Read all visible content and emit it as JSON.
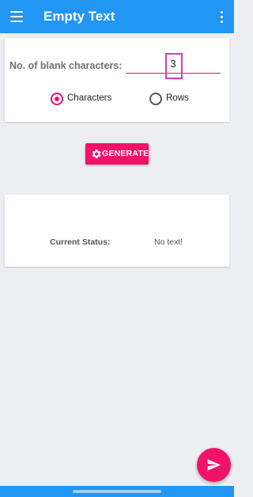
{
  "appbar": {
    "title": "Empty Text",
    "menu_icon": "hamburger-menu-icon",
    "more_icon": "more-vertical-icon",
    "color": "#2196f3"
  },
  "form": {
    "label": "No. of blank characters:",
    "input_value": "3",
    "radio_options": [
      {
        "label": "Characters",
        "checked": true
      },
      {
        "label": "Rows",
        "checked": false
      }
    ]
  },
  "generate_button": {
    "label": "GENERATE",
    "icon": "gear-icon"
  },
  "status": {
    "label": "Current Status:",
    "value": "No text!"
  },
  "fab": {
    "icon": "send-icon"
  },
  "colors": {
    "accent": "#f0136a",
    "primary": "#2196f3",
    "highlight": "#d63eb9"
  }
}
